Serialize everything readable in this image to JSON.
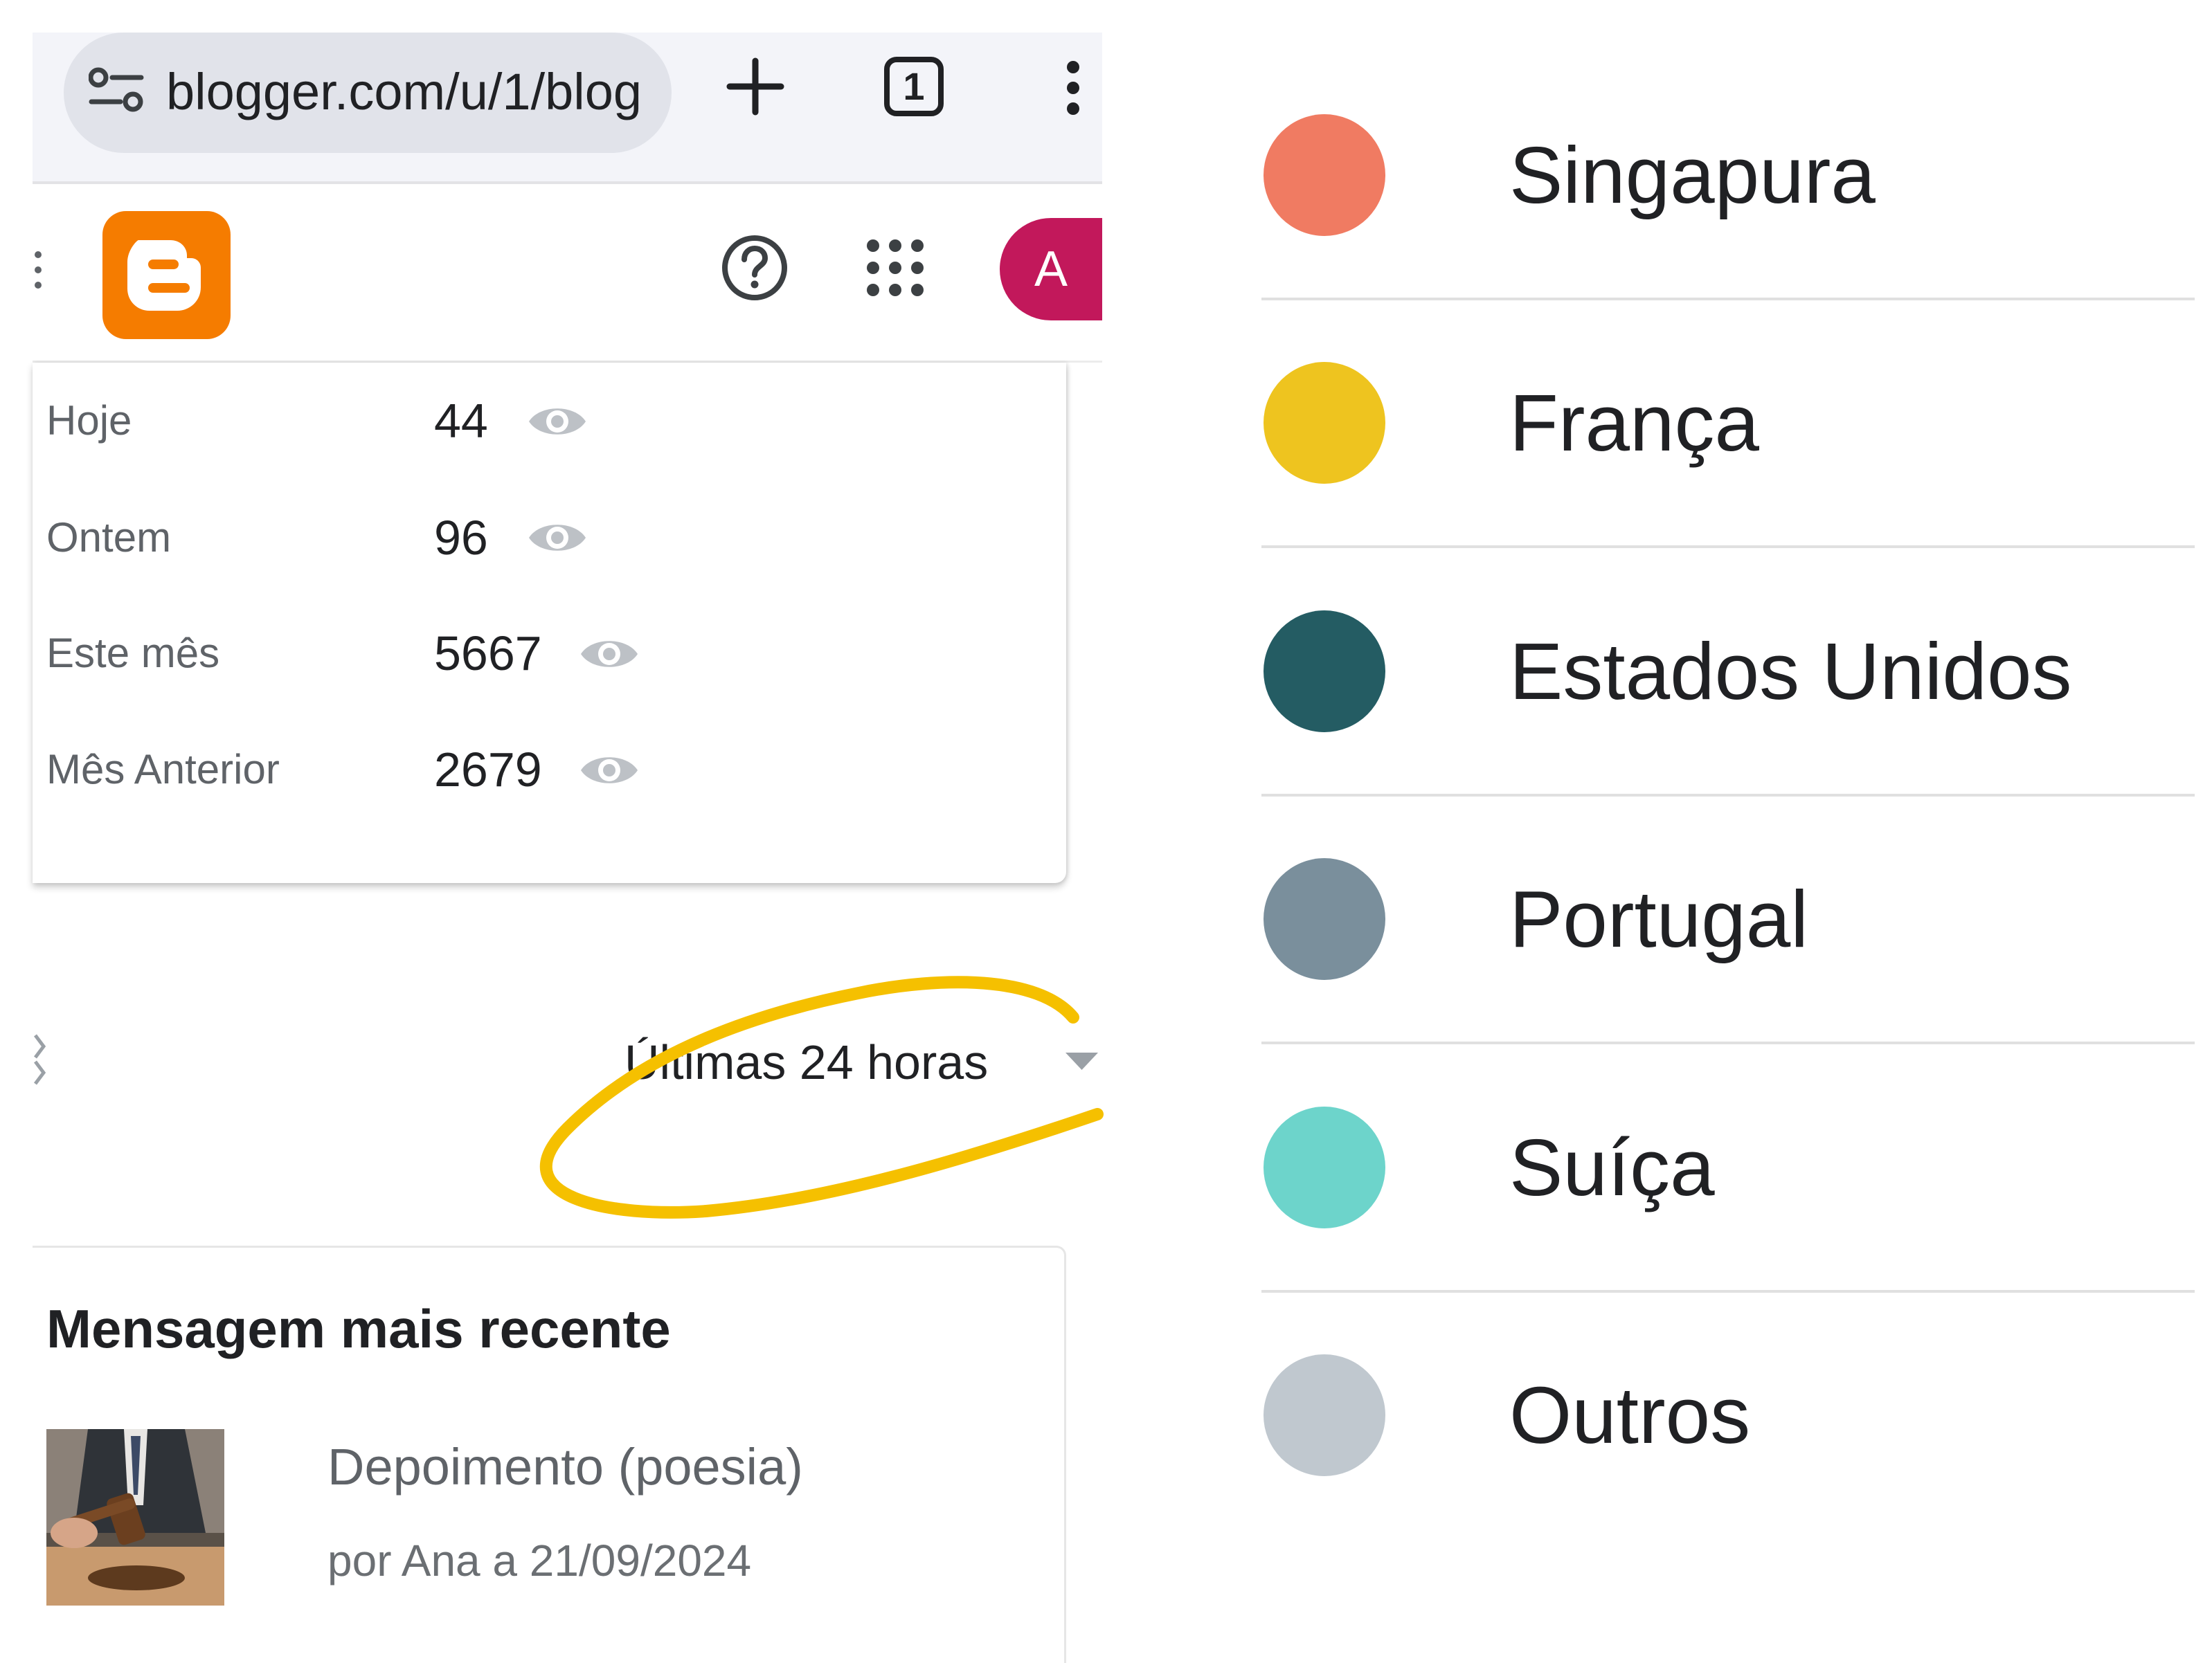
{
  "browser": {
    "url": "blogger.com/u/1/blog",
    "tab_count": "1",
    "icons": [
      "site-settings-icon",
      "new-tab-icon",
      "tab-switcher-icon",
      "more-vert-icon"
    ]
  },
  "header": {
    "logo": "blogger-logo",
    "icons": [
      "help-icon",
      "apps-icon"
    ],
    "avatar_letter": "A",
    "avatar_color": "#c2185b",
    "logo_color": "#f57c00"
  },
  "stats": {
    "rows": [
      {
        "label": "Hoje",
        "value": "44"
      },
      {
        "label": "Ontem",
        "value": "96"
      },
      {
        "label": "Este mês",
        "value": "5667"
      },
      {
        "label": "Mês Anterior",
        "value": "2679"
      }
    ]
  },
  "filter": {
    "selected": "Últimas 24 horas",
    "highlight_color": "#f5c000"
  },
  "recent_post": {
    "heading": "Mensagem mais recente",
    "title": "Depoimento (poesia)",
    "meta": "por Ana a 21/09/2024"
  },
  "legend": {
    "items": [
      {
        "label": "Singapura",
        "color": "#f07b62"
      },
      {
        "label": "França",
        "color": "#eec41f"
      },
      {
        "label": "Estados Unidos",
        "color": "#245c63"
      },
      {
        "label": "Portugal",
        "color": "#7a8f9c"
      },
      {
        "label": "Suíça",
        "color": "#6dd4cb"
      },
      {
        "label": "Outros",
        "color": "#c0c8cf"
      }
    ]
  }
}
